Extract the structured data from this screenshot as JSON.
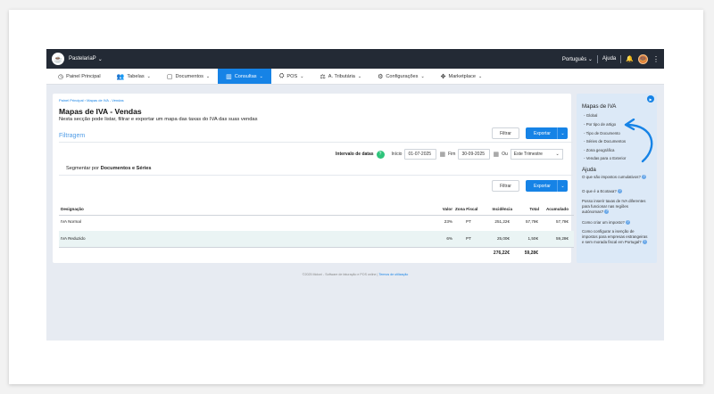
{
  "topbar": {
    "company": "PastelariaP",
    "language": "Português",
    "help": "Ajuda"
  },
  "nav": [
    {
      "label": "Painel Principal",
      "icon": "clock-icon",
      "glyph": "◷",
      "chevron": ""
    },
    {
      "label": "Tabelas",
      "icon": "users-icon",
      "glyph": "👥",
      "chevron": "⌄"
    },
    {
      "label": "Documentos",
      "icon": "document-icon",
      "glyph": "▢",
      "chevron": "⌄"
    },
    {
      "label": "Consultas",
      "icon": "chart-icon",
      "glyph": "▥",
      "chevron": "⌄"
    },
    {
      "label": "POS",
      "icon": "pos-icon",
      "glyph": "⛭",
      "chevron": "⌄"
    },
    {
      "label": "A. Tributária",
      "icon": "tax-icon",
      "glyph": "⚖",
      "chevron": "⌄"
    },
    {
      "label": "Configurações",
      "icon": "settings-icon",
      "glyph": "⚙",
      "chevron": "⌄"
    },
    {
      "label": "Marketplace",
      "icon": "marketplace-icon",
      "glyph": "✥",
      "chevron": "⌄"
    }
  ],
  "page": {
    "breadcrumb": "Painel Principal  ›  Mapas de IVA - Vendas",
    "title": "Mapas de IVA - Vendas",
    "subtitle": "Nesta secção pode listar, filtrar e exportar um mapa das taxas do IVA das suas vendas",
    "filter_section": "Filtragem",
    "filter_button": "Filtrar",
    "export_button": "Exportar",
    "date_interval_label": "Intervalo de datas",
    "start_label": "Início",
    "start_value": "01-07-2025",
    "end_label": "Fim",
    "end_value": "30-09-2025",
    "or_label": "Ou",
    "period_value": "Este Trimestre",
    "segment_prefix": "Segmentar por",
    "segment_value": "Documentos e Séries"
  },
  "table": {
    "headers": [
      "Designação",
      "Valor",
      "Zona Fiscal",
      "Incidência",
      "Total",
      "Acumulado"
    ],
    "rows": [
      [
        "IVA Normal",
        "23%",
        "PT",
        "251,22€",
        "57,78€",
        "57,78€"
      ],
      [
        "IVA Reduzido",
        "6%",
        "PT",
        "25,00€",
        "1,50€",
        "59,28€"
      ]
    ],
    "totals": {
      "incidencia": "276,22€",
      "total": "59,28€"
    }
  },
  "sidebar": {
    "heading": "Mapas de IVA",
    "links": [
      "Global",
      "Por tipo de artigo",
      "Tipo de Documento",
      "Séries de Documentos",
      "Zona geográfica",
      "Vendas para o Exterior"
    ],
    "help_heading": "Ajuda",
    "help_links": [
      "O que são impostos cumulativos?",
      "O que é a Ecotaxa?",
      "Posso inserir taxas de IVA diferentes para funcionar nas regiões autónomas?",
      "Como criar um imposto?",
      "Como configurar a isenção de impostos para empresas estrangeiras e sem morada fiscal em Portugal?"
    ]
  },
  "footer": {
    "text": "©2025 Moloni - Software de faturação e POS online",
    "link": "Termos de utilização"
  },
  "colors": {
    "primary": "#1683e6",
    "topbar": "#232a35",
    "sidebar": "#dce9f7",
    "help_badge": "#2ec47b"
  }
}
